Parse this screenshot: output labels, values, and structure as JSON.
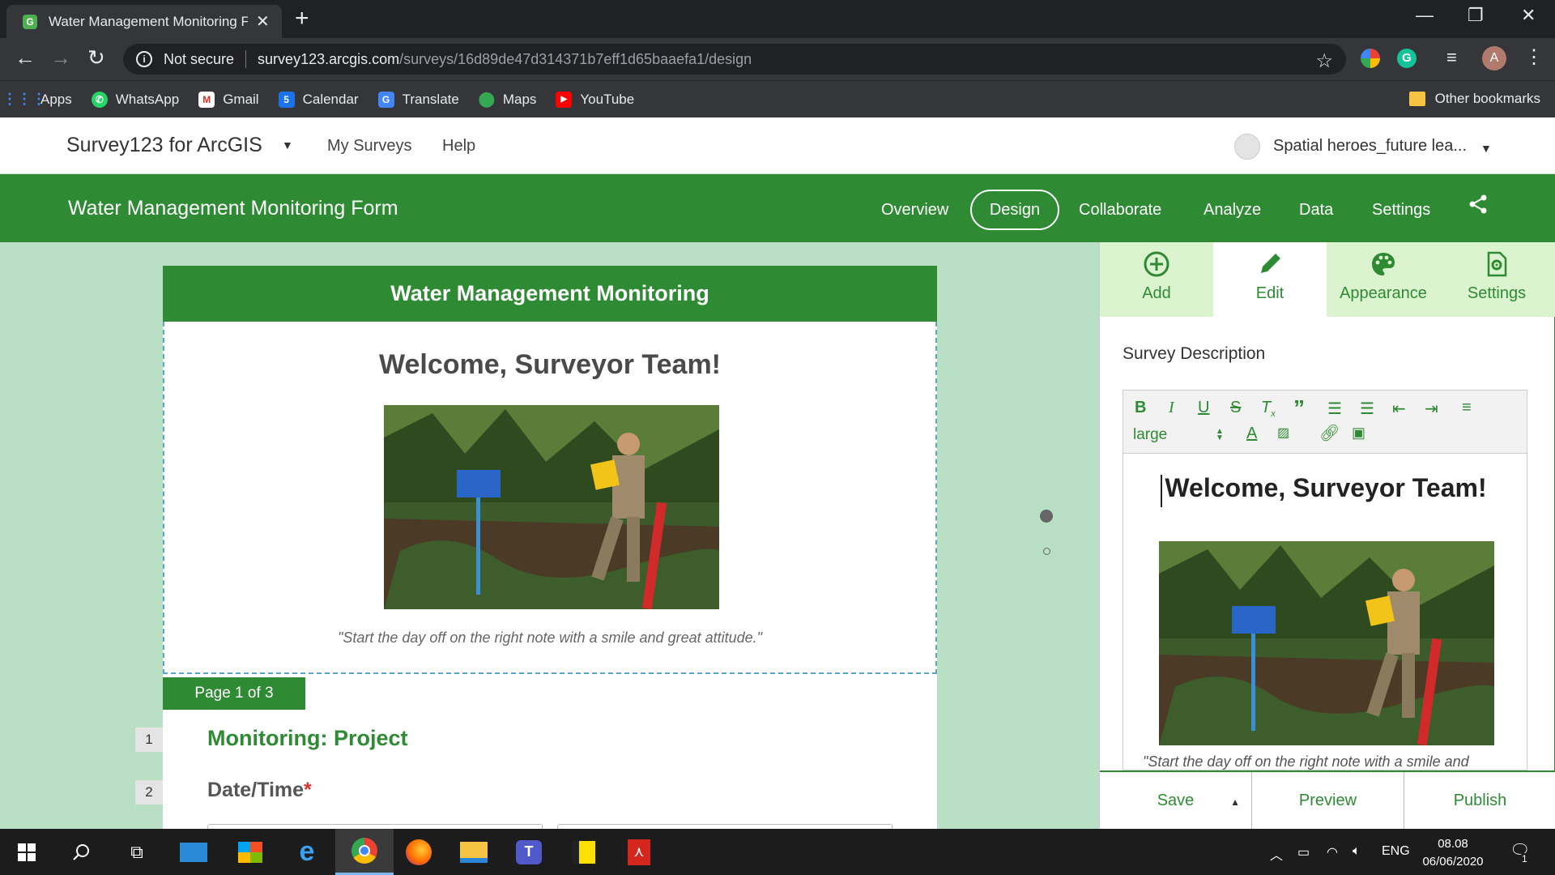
{
  "browser": {
    "tab_title": "Water Management Monitoring F",
    "tab_favicon": "G",
    "security_label": "Not secure",
    "url_host": "survey123.arcgis.com",
    "url_path": "/surveys/16d89de47d314371b7eff1d65baaefa1/design",
    "profile_initial": "A",
    "bookmarks": [
      {
        "label": "Apps",
        "icon": "apps-grid-icon",
        "color": "#4285f4"
      },
      {
        "label": "WhatsApp",
        "icon": "whatsapp-icon",
        "color": "#25d366"
      },
      {
        "label": "Gmail",
        "icon": "gmail-icon",
        "color": "#d93025"
      },
      {
        "label": "Calendar",
        "icon": "calendar-icon",
        "color": "#1a73e8"
      },
      {
        "label": "Translate",
        "icon": "translate-icon",
        "color": "#4285f4"
      },
      {
        "label": "Maps",
        "icon": "maps-icon",
        "color": "#34a853"
      },
      {
        "label": "YouTube",
        "icon": "youtube-icon",
        "color": "#ff0000"
      }
    ],
    "other_bookmarks": "Other bookmarks"
  },
  "app": {
    "title": "Survey123 for ArcGIS",
    "links": [
      "My Surveys",
      "Help"
    ],
    "user_name": "Spatial heroes_future lea..."
  },
  "greenbar": {
    "form_title": "Water Management Monitoring Form",
    "nav": {
      "overview": "Overview",
      "design": "Design",
      "collaborate": "Collaborate",
      "analyze": "Analyze",
      "data": "Data",
      "settings": "Settings"
    }
  },
  "form": {
    "header": "Water Management Monitoring",
    "welcome": "Welcome, Surveyor Team!",
    "quote": "\"Start the day off on the right note with a smile and great attitude.\"",
    "page_badge": "Page 1 of 3",
    "questions": [
      {
        "number": "1",
        "label": "Monitoring: Project"
      },
      {
        "number": "2",
        "label": "Date/Time",
        "required_mark": "*"
      }
    ]
  },
  "panel": {
    "tabs": {
      "add": "Add",
      "edit": "Edit",
      "appearance": "Appearance",
      "settings": "Settings"
    },
    "section_label": "Survey Description",
    "font_size": "large",
    "editor_welcome": "Welcome, Surveyor Team!",
    "editor_quote": "\"Start the day off on the right note with a smile and",
    "footer": {
      "save": "Save",
      "preview": "Preview",
      "publish": "Publish"
    }
  },
  "taskbar": {
    "language": "ENG",
    "time": "08.08",
    "date": "06/06/2020",
    "notifications": "1"
  },
  "colors": {
    "brand_green": "#2e8b34",
    "canvas_bg": "#b9dfc5",
    "tab_bg": "#dcf3cf"
  }
}
